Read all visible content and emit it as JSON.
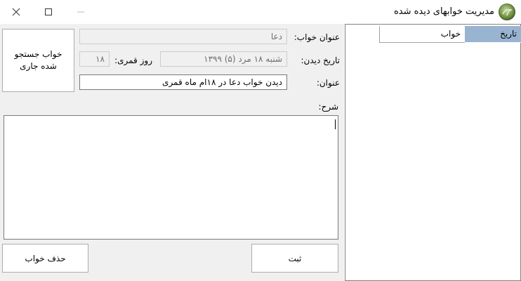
{
  "window": {
    "title": "مدیریت خوابهای دیده شده"
  },
  "form": {
    "search_button": "خواب جستجو شده جاری",
    "dream_title_label": "عنوان خواب:",
    "dream_title_value": "دعا",
    "seen_date_label": "تاریخ دیدن:",
    "seen_date_value": "شنبه ۱۸ مرد (۵) ۱۳۹۹",
    "lunar_day_label": "روز قمری:",
    "lunar_day_value": "۱۸",
    "subject_label": "عنوان:",
    "subject_value": "دیدن خواب دعا در ۱۸ام ماه قمری",
    "description_label": "شرح:",
    "description_value": ""
  },
  "actions": {
    "save_label": "ثبت",
    "delete_label": "حذف خواب"
  },
  "list": {
    "columns": [
      "تاریخ",
      "خواب"
    ],
    "rows": []
  },
  "colors": {
    "selected_header": "#99b4d1",
    "form_background": "#f0f0f0"
  }
}
